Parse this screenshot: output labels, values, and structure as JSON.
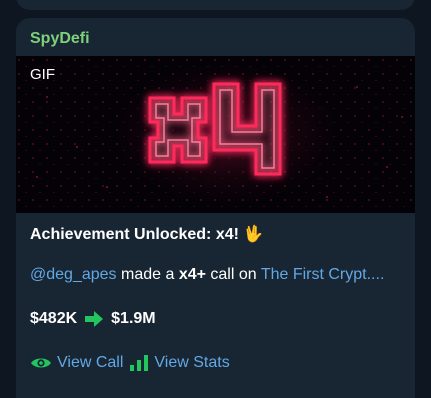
{
  "message": {
    "sender": "SpyDefi",
    "media_label": "GIF",
    "gif_text": "x4",
    "title": "Achievement Unlocked: x4!",
    "title_emoji": "🖖",
    "user_link": "@deg_apes",
    "text_made": "made a",
    "text_call": "x4+",
    "text_call_on": "call on",
    "token_link": "The First Crypt....",
    "price_from": "$482K",
    "price_to": "$1.9M",
    "actions": [
      {
        "label": "View Call",
        "icon": "eye-icon"
      },
      {
        "label": "View Stats",
        "icon": "bar-chart-icon"
      }
    ]
  },
  "colors": {
    "background": "#0e1621",
    "bubble": "#182533",
    "sender": "#7ed07a",
    "link": "#62a8e5",
    "neon": "#ff2a5c",
    "arrow": "#22c55e"
  }
}
